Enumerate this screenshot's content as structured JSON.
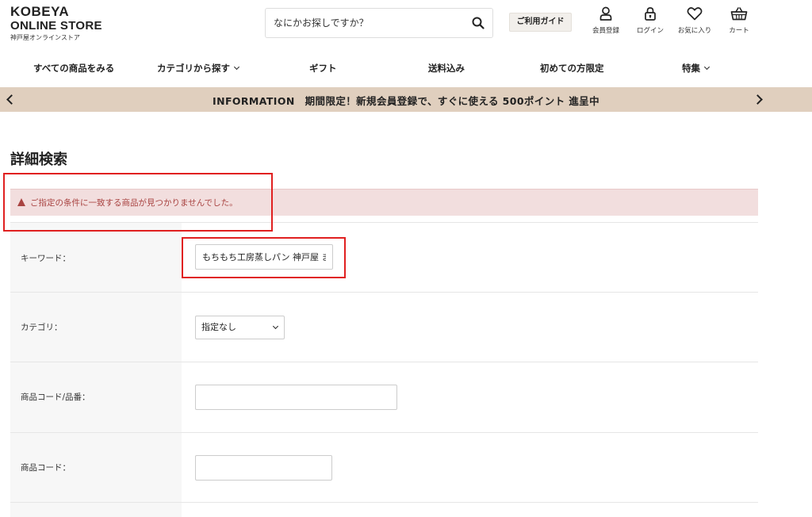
{
  "header": {
    "logo_line1": "KOBEYA",
    "logo_line2": "ONLINE STORE",
    "logo_sub": "神戸屋オンラインストア",
    "search_placeholder": "なにかお探しですか？",
    "guide_label": "ご利用ガイド",
    "icons": [
      {
        "name": "person-icon",
        "label": "会員登録"
      },
      {
        "name": "lock-icon",
        "label": "ログイン"
      },
      {
        "name": "heart-icon",
        "label": "お気に入り"
      },
      {
        "name": "cart-icon",
        "label": "カート"
      }
    ]
  },
  "nav": {
    "items": [
      {
        "label": "すべての商品をみる"
      },
      {
        "label": "カテゴリから探す"
      },
      {
        "label": "ギフト"
      },
      {
        "label": "送料込み"
      },
      {
        "label": "初めての方限定"
      },
      {
        "label": "特集"
      }
    ]
  },
  "info": {
    "text": "INFORMATION　期間限定！新規会員登録で、すぐに使える 500ポイント 進呈中"
  },
  "main": {
    "title": "詳細検索",
    "alert": "ご指定の条件に一致する商品が見つかりませんでした。",
    "form": {
      "keyword_label": "キーワード：",
      "keyword_value": "もちもち工房蒸しパン 神戸屋 ま",
      "category_label": "カテゴリ：",
      "category_value": "指定なし",
      "product_code_label": "商品コード/品番：",
      "product_code_value": "",
      "code_label": "商品コード：",
      "code_value": ""
    }
  },
  "colors": {
    "info_bar": "#e0cfbe",
    "alert_bg": "#f2dede",
    "alert_text": "#a94442",
    "highlight": "#e02020"
  }
}
